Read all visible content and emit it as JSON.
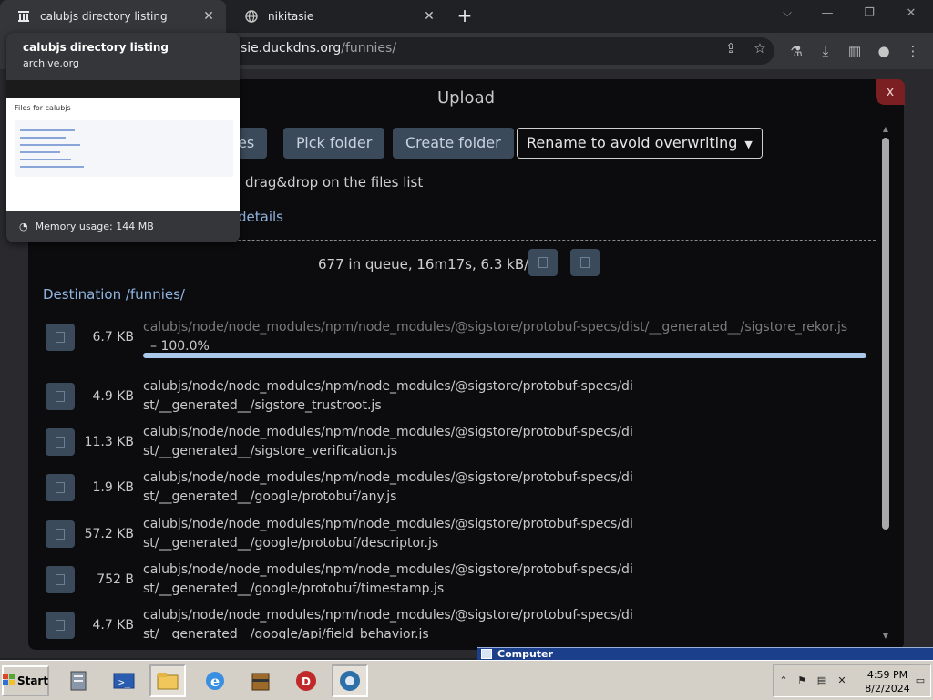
{
  "browser": {
    "tabs": [
      {
        "title": "calubjs directory listing",
        "close": "✕"
      },
      {
        "title": "nikitasie",
        "close": "✕"
      }
    ],
    "new_tab": "+",
    "window_controls": {
      "collapse": "⌵",
      "minimize": "—",
      "restore": "❐",
      "close": "✕"
    },
    "address": {
      "host": "sie.duckdns.org",
      "path": "/funnies/"
    }
  },
  "hover_card": {
    "title": "calubjs directory listing",
    "domain": "archive.org",
    "thumb_text": "Files for calubjs",
    "memory": "Memory usage: 144 MB"
  },
  "upload": {
    "title": "Upload",
    "close": "x",
    "buttons": {
      "pick_files_partial": "es",
      "pick_folder": "Pick folder",
      "create_folder": "Create folder"
    },
    "conflict_select": "Rename to avoid overwriting",
    "drop_hint": "drag&drop on the files list",
    "details_link": "details",
    "queue_status": "677 in queue, 16m17s, 6.3 kB/s",
    "destination": "Destination /funnies/",
    "files": [
      {
        "size": "6.7 KB",
        "name": "calubjs/node/node_modules/npm/node_modules/@sigstore/protobuf-specs/dist/__generated__/sigstore_rekor.js",
        "progress_text": "– 100.0%",
        "progress": 1.0
      },
      {
        "size": "4.9 KB",
        "name": "calubjs/node/node_modules/npm/node_modules/@sigstore/protobuf-specs/dist/__generated__/sigstore_trustroot.js"
      },
      {
        "size": "11.3 KB",
        "name": "calubjs/node/node_modules/npm/node_modules/@sigstore/protobuf-specs/dist/__generated__/sigstore_verification.js"
      },
      {
        "size": "1.9 KB",
        "name": "calubjs/node/node_modules/npm/node_modules/@sigstore/protobuf-specs/dist/__generated__/google/protobuf/any.js"
      },
      {
        "size": "57.2 KB",
        "name": "calubjs/node/node_modules/npm/node_modules/@sigstore/protobuf-specs/dist/__generated__/google/protobuf/descriptor.js"
      },
      {
        "size": "752 B",
        "name": "calubjs/node/node_modules/npm/node_modules/@sigstore/protobuf-specs/dist/__generated__/google/protobuf/timestamp.js"
      },
      {
        "size": "4.7 KB",
        "name": "calubjs/node/node_modules/npm/node_modules/@sigstore/protobuf-specs/dist/__generated__/google/api/field_behavior.js"
      }
    ]
  },
  "taskbar": {
    "start": "Start",
    "computer_window_title": "Computer",
    "time": "4:59 PM",
    "date": "8/2/2024"
  },
  "colors": {
    "accent_button": "#3b4a5b",
    "progress": "#aac8ea",
    "link": "#8fb4e0",
    "close_red": "#7c1f23"
  },
  "icons": [
    "archive-icon",
    "globe-icon",
    "share-icon",
    "star-icon",
    "lab-icon",
    "download-icon",
    "sidepanel-icon",
    "profile-icon",
    "menu-icon",
    "memory-icon",
    "windows-flag-icon"
  ]
}
